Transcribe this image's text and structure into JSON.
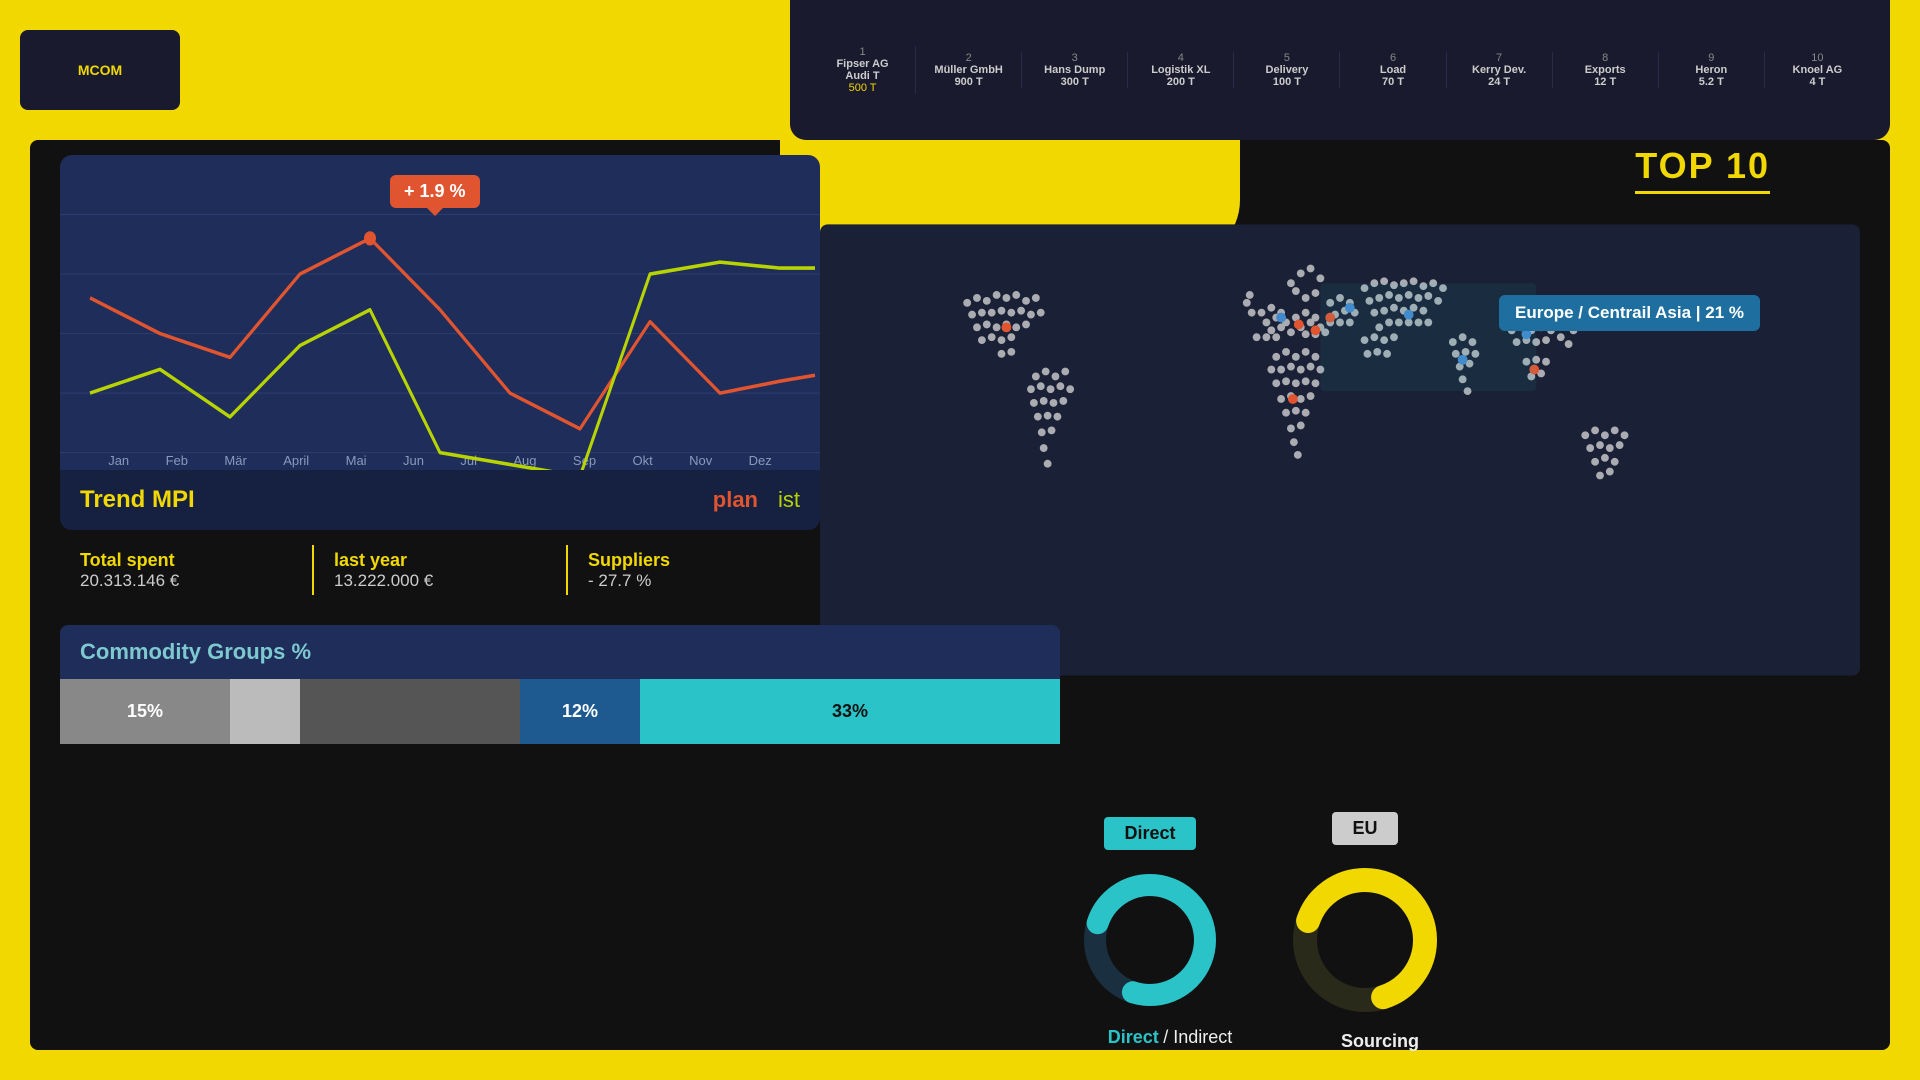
{
  "colors": {
    "yellow": "#f0d800",
    "dark_bg": "#111111",
    "chart_bg": "#1e2d5a",
    "teal": "#2ac4c8",
    "orange": "#e05530",
    "green_line": "#b8d400",
    "blue_tooltip": "#1e6fa0",
    "map_bg": "#1a2035"
  },
  "header": {
    "logo": "MCOM",
    "top10_label": "TOP 10",
    "items": [
      {
        "rank": "1",
        "name": "Fipser AG\nAudi T",
        "value": "500 T"
      },
      {
        "rank": "2",
        "name": "Müller GmbH\n900 T",
        "value": ""
      },
      {
        "rank": "3",
        "name": "Hans Dump\n300 T",
        "value": ""
      },
      {
        "rank": "4",
        "name": "Logistik XL\n200 T",
        "value": ""
      },
      {
        "rank": "5",
        "name": "Delivery\n100 T",
        "value": ""
      },
      {
        "rank": "6",
        "name": "Load\n70 T",
        "value": ""
      },
      {
        "rank": "7",
        "name": "Kerry Dev.\n24 T",
        "value": ""
      },
      {
        "rank": "8",
        "name": "Exports\n12 T",
        "value": ""
      },
      {
        "rank": "9",
        "name": "Heron\n5.2 T",
        "value": ""
      },
      {
        "rank": "10",
        "name": "Knoel AG\n4 T",
        "value": ""
      }
    ]
  },
  "chart": {
    "title": "Trend MPI",
    "tooltip": "+ 1.9 %",
    "legend_plan": "plan",
    "legend_ist": "ist",
    "months": [
      "Jan",
      "Feb",
      "Mär",
      "April",
      "Mai",
      "Jun",
      "Jul",
      "Aug",
      "Sep",
      "Okt",
      "Nov",
      "Dez"
    ]
  },
  "stats": {
    "total_spent_label": "Total spent",
    "total_spent_value": "20.313.146 €",
    "last_year_label": "last year",
    "last_year_value": "13.222.000 €",
    "suppliers_label": "Suppliers",
    "suppliers_value": "- 27.7 %"
  },
  "commodity": {
    "title": "Commodity Groups %",
    "bars": [
      {
        "value": "15%",
        "color": "#888",
        "width": 17
      },
      {
        "value": "",
        "color": "#aaa",
        "width": 7
      },
      {
        "value": "",
        "color": "#666",
        "width": 22
      },
      {
        "value": "12%",
        "color": "#2a6aa0",
        "width": 12
      },
      {
        "value": "33%",
        "color": "#2ac4c8",
        "width": 42
      }
    ]
  },
  "map": {
    "tooltip": "Europe / Centrail Asia | 21 %"
  },
  "donut_direct": {
    "label": "Direct",
    "percentage": 75,
    "color": "#2ac4c8",
    "track_color": "#1a3040"
  },
  "donut_eu": {
    "label": "EU",
    "percentage": 65,
    "color": "#f0d800",
    "track_color": "#1a1a1a"
  },
  "bottom_labels": {
    "direct": "Direct",
    "indirect": "/ Indirect",
    "sourcing": "Sourcing"
  }
}
